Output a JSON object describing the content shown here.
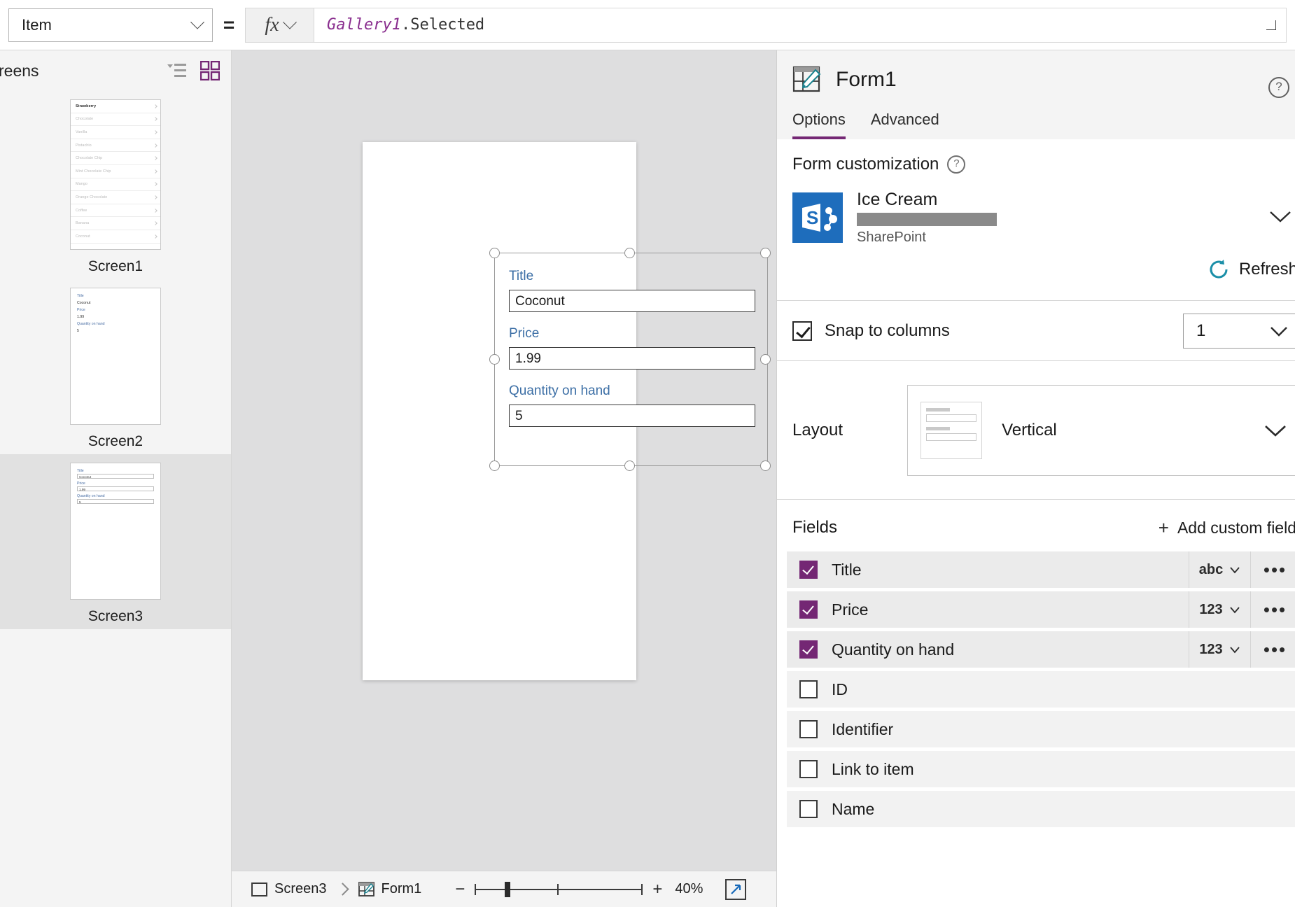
{
  "formula_bar": {
    "property_value": "Item",
    "equals": "=",
    "fx_label": "fx",
    "formula_control": "Gallery1",
    "formula_dot": ".",
    "formula_property": "Selected"
  },
  "sidebar": {
    "title": "reens",
    "view_tree_icon": "tree-view-icon",
    "view_grid_icon": "grid-view-icon",
    "screens": [
      {
        "label": "Screen1",
        "type": "gallery",
        "selected": false,
        "items": [
          "Strawberry",
          "Chocolate",
          "Vanilla",
          "Pistachio",
          "Chocolate Chip",
          "Mint Chocolate Chip",
          "Mango",
          "Orange Chocolate",
          "Coffee",
          "Banana",
          "Coconut"
        ]
      },
      {
        "label": "Screen2",
        "type": "form",
        "selected": false,
        "fields": [
          {
            "label": "Title",
            "value": "Coconut"
          },
          {
            "label": "Price",
            "value": "1.99"
          },
          {
            "label": "Quantity on hand",
            "value": "5"
          }
        ]
      },
      {
        "label": "Screen3",
        "type": "form-boxed",
        "selected": true,
        "fields": [
          {
            "label": "Title",
            "value": "Coconut"
          },
          {
            "label": "Price",
            "value": "1.99"
          },
          {
            "label": "Quantity on hand",
            "value": "5"
          }
        ]
      }
    ]
  },
  "canvas": {
    "form_fields": [
      {
        "label": "Title",
        "value": "Coconut"
      },
      {
        "label": "Price",
        "value": "1.99"
      },
      {
        "label": "Quantity on hand",
        "value": "5"
      }
    ]
  },
  "bottom_bar": {
    "breadcrumb": [
      {
        "label": "Screen3",
        "icon": "screen-icon"
      },
      {
        "label": "Form1",
        "icon": "form-icon"
      }
    ],
    "zoom_minus": "−",
    "zoom_plus": "+",
    "zoom_percent": "40%",
    "fit_icon": "fit-to-screen-icon"
  },
  "right_panel": {
    "title": "Form1",
    "title_icon": "form-edit-icon",
    "help_icon": "?",
    "tabs": [
      {
        "label": "Options",
        "active": true
      },
      {
        "label": "Advanced",
        "active": false
      }
    ],
    "customization": {
      "heading": "Form customization",
      "help_badge": "?",
      "datasource_name": "Ice Cream",
      "datasource_type": "SharePoint",
      "datasource_icon": "sharepoint-icon",
      "refresh_label": "Refresh",
      "refresh_icon": "refresh-icon"
    },
    "snap": {
      "label": "Snap to columns",
      "checked": true,
      "columns_value": "1"
    },
    "layout": {
      "label": "Layout",
      "value": "Vertical",
      "preview_icon": "vertical-layout-icon"
    },
    "fields": {
      "heading": "Fields",
      "add_label": "Add custom field",
      "add_icon": "plus-icon",
      "more_icon": "•••",
      "rows": [
        {
          "name": "Title",
          "checked": true,
          "type": "abc"
        },
        {
          "name": "Price",
          "checked": true,
          "type": "123"
        },
        {
          "name": "Quantity on hand",
          "checked": true,
          "type": "123"
        },
        {
          "name": "ID",
          "checked": false,
          "type": ""
        },
        {
          "name": "Identifier",
          "checked": false,
          "type": ""
        },
        {
          "name": "Link to item",
          "checked": false,
          "type": ""
        },
        {
          "name": "Name",
          "checked": false,
          "type": ""
        }
      ]
    }
  },
  "colors": {
    "accent_purple": "#742774",
    "formula_control": "#8a2f8f",
    "field_label_blue": "#3b6ea5",
    "sharepoint_blue": "#1e6dbc"
  }
}
